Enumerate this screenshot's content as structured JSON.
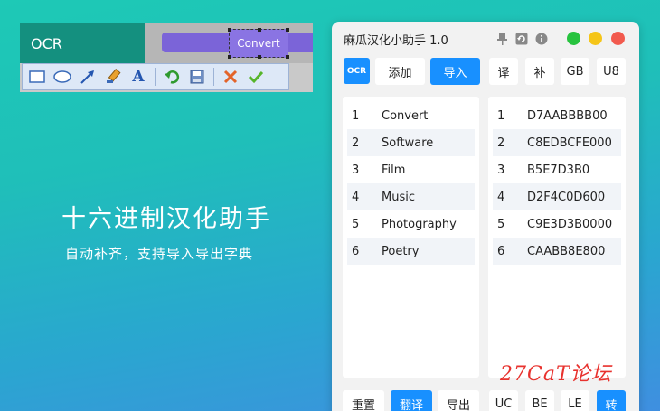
{
  "ocr_demo": {
    "label": "OCR",
    "selection_text": "Convert",
    "tools": [
      "rectangle-icon",
      "ellipse-icon",
      "arrow-icon",
      "highlighter-icon",
      "text-icon",
      "undo-icon",
      "save-icon",
      "cancel-icon",
      "confirm-icon"
    ]
  },
  "promo": {
    "title": "十六进制汉化助手",
    "subtitle": "自动补齐，支持导入导出字典"
  },
  "app": {
    "title": "麻瓜汉化小助手 1.0",
    "titlebar_icons": [
      "pin-icon",
      "refresh-icon",
      "info-icon"
    ],
    "window_dots": {
      "green": "#27c33f",
      "yellow": "#f5c518",
      "red": "#f25a4e"
    },
    "toolbar": {
      "ocr": "OCR",
      "add": "添加",
      "import": "导入",
      "translate_short": "译",
      "complete_short": "补",
      "gb": "GB",
      "u8": "U8"
    },
    "left_list": [
      {
        "num": "1",
        "text": "Convert"
      },
      {
        "num": "2",
        "text": "Software"
      },
      {
        "num": "3",
        "text": "Film"
      },
      {
        "num": "4",
        "text": "Music"
      },
      {
        "num": "5",
        "text": "Photography"
      },
      {
        "num": "6",
        "text": "Poetry"
      }
    ],
    "right_list": [
      {
        "num": "1",
        "text": "D7AABBBB00"
      },
      {
        "num": "2",
        "text": "C8EDBCFE000"
      },
      {
        "num": "3",
        "text": "B5E7D3B0"
      },
      {
        "num": "4",
        "text": "D2F4C0D600"
      },
      {
        "num": "5",
        "text": "C9E3D3B0000"
      },
      {
        "num": "6",
        "text": "CAABB8E800"
      }
    ],
    "bottom": {
      "reset": "重置",
      "translate": "翻译",
      "export": "导出",
      "uc": "UC",
      "be": "BE",
      "le": "LE",
      "convert": "转"
    },
    "accent": "#1890ff"
  },
  "watermark": "27CaT论坛"
}
